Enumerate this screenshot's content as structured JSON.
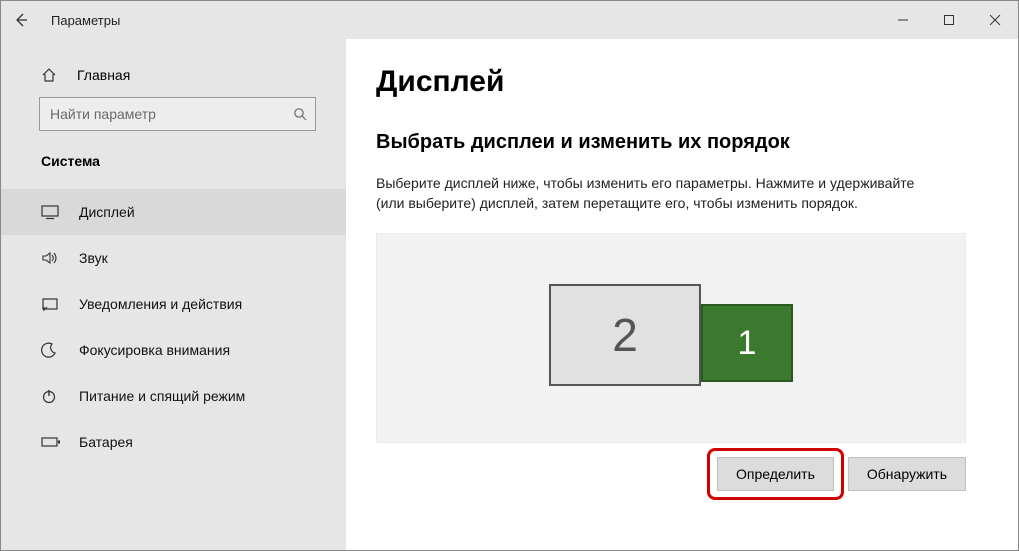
{
  "titlebar": {
    "title": "Параметры"
  },
  "sidebar": {
    "home": "Главная",
    "search_placeholder": "Найти параметр",
    "section": "Система",
    "items": [
      {
        "label": "Дисплей"
      },
      {
        "label": "Звук"
      },
      {
        "label": "Уведомления и действия"
      },
      {
        "label": "Фокусировка внимания"
      },
      {
        "label": "Питание и спящий режим"
      },
      {
        "label": "Батарея"
      }
    ]
  },
  "main": {
    "h1": "Дисплей",
    "h2": "Выбрать дисплеи и изменить их порядок",
    "desc": "Выберите дисплей ниже, чтобы изменить его параметры. Нажмите и удерживайте (или выберите) дисплей, затем перетащите его, чтобы изменить порядок.",
    "monitors": {
      "primary": "1",
      "secondary": "2"
    },
    "buttons": {
      "identify": "Определить",
      "detect": "Обнаружить"
    }
  }
}
